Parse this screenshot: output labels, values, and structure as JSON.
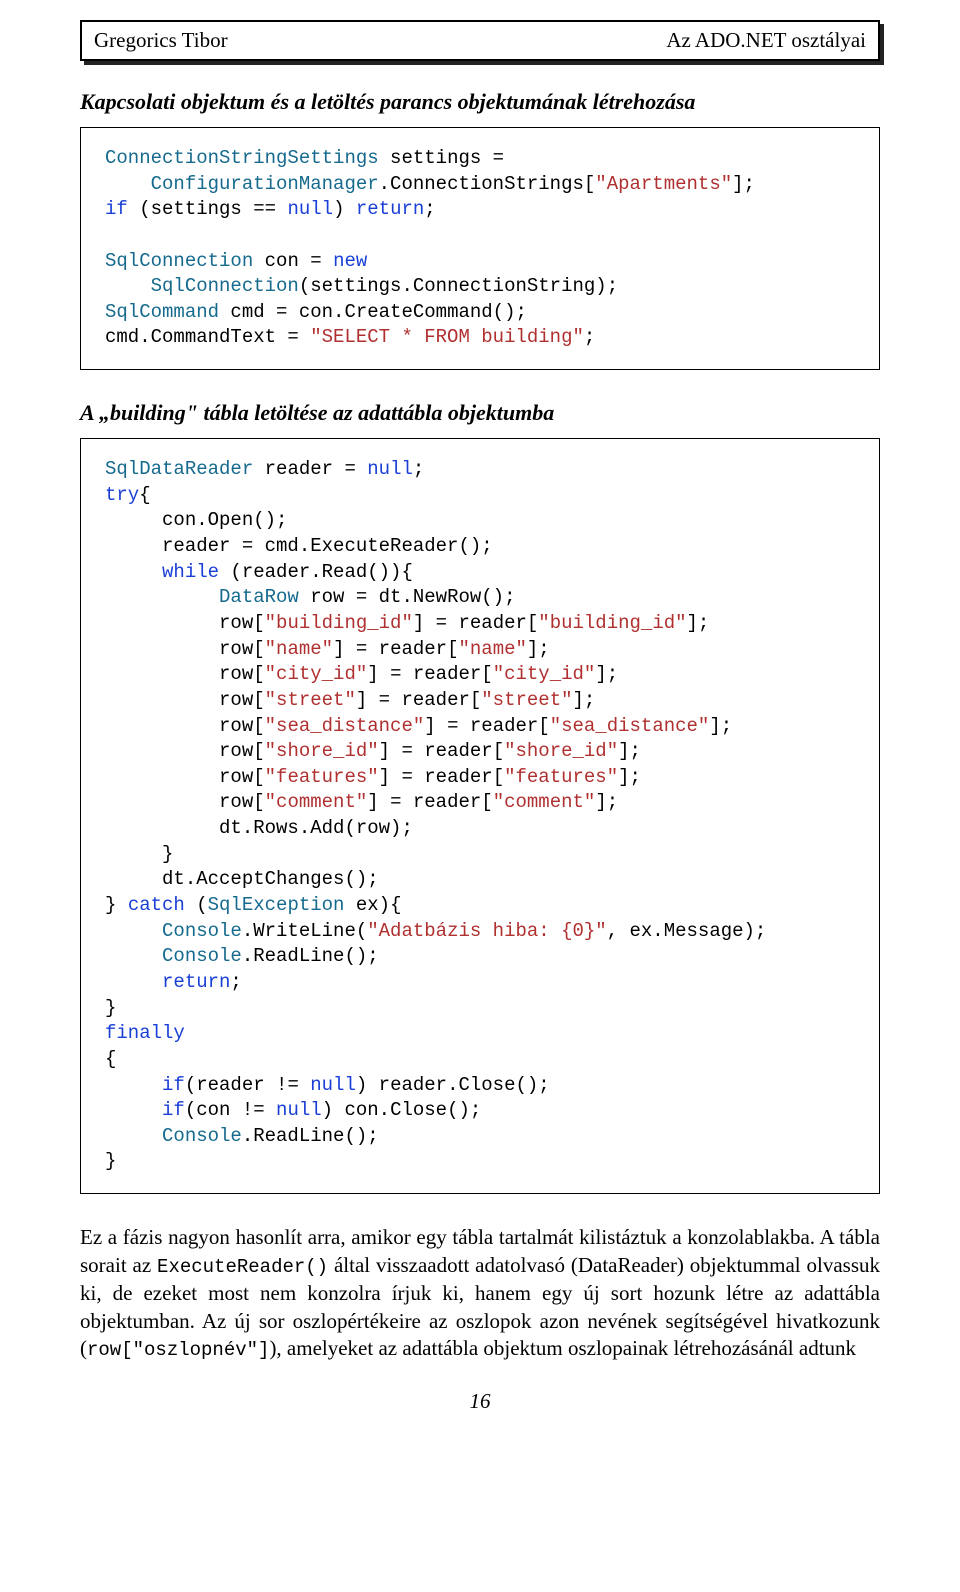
{
  "header": {
    "left": "Gregorics Tibor",
    "right": "Az ADO.NET osztályai"
  },
  "section1": {
    "title_lead": "Kapcsolati objektum és a letöltés parancs objektumának létrehozása"
  },
  "code1": {
    "l1": "ConnectionStringSettings",
    "l1b": " settings = ",
    "l2": "    ConfigurationManager",
    "l2b": ".ConnectionStrings[",
    "l2c": "\"Apartments\"",
    "l2d": "];",
    "l3a": "if",
    "l3b": " (settings == ",
    "l3c": "null",
    "l3d": ") ",
    "l3e": "return",
    "l3f": ";",
    "l5a": "SqlConnection",
    "l5b": " con = ",
    "l5c": "new",
    "l6a": "    SqlConnection",
    "l6b": "(settings.ConnectionString);",
    "l7a": "SqlCommand",
    "l7b": " cmd = con.CreateCommand();",
    "l8a": "cmd.CommandText = ",
    "l8b": "\"SELECT * FROM building\"",
    "l8c": ";"
  },
  "section2": {
    "title_lead": "A „building\" tábla letöltése az adattábla objektumba"
  },
  "code2": {
    "l1a": "SqlDataReader",
    "l1b": " reader = ",
    "l1c": "null",
    "l1d": ";",
    "l2a": "try",
    "l2b": "{",
    "l3": "     con.Open();",
    "l4": "     reader = cmd.ExecuteReader();",
    "l5a": "     while",
    "l5b": " (reader.Read()){",
    "l6a": "          DataRow",
    "l6b": " row = dt.NewRow();",
    "l7a": "          row[",
    "l7b": "\"building_id\"",
    "l7c": "] = reader[",
    "l7d": "\"building_id\"",
    "l7e": "];",
    "l8a": "          row[",
    "l8b": "\"name\"",
    "l8c": "] = reader[",
    "l8d": "\"name\"",
    "l8e": "];",
    "l9a": "          row[",
    "l9b": "\"city_id\"",
    "l9c": "] = reader[",
    "l9d": "\"city_id\"",
    "l9e": "];",
    "l10a": "          row[",
    "l10b": "\"street\"",
    "l10c": "] = reader[",
    "l10d": "\"street\"",
    "l10e": "];",
    "l11a": "          row[",
    "l11b": "\"sea_distance\"",
    "l11c": "] = reader[",
    "l11d": "\"sea_distance\"",
    "l11e": "];",
    "l12a": "          row[",
    "l12b": "\"shore_id\"",
    "l12c": "] = reader[",
    "l12d": "\"shore_id\"",
    "l12e": "];",
    "l13a": "          row[",
    "l13b": "\"features\"",
    "l13c": "] = reader[",
    "l13d": "\"features\"",
    "l13e": "];",
    "l14a": "          row[",
    "l14b": "\"comment\"",
    "l14c": "] = reader[",
    "l14d": "\"comment\"",
    "l14e": "];",
    "l15": "          dt.Rows.Add(row);",
    "l16": "     }",
    "l17": "     dt.AcceptChanges();",
    "l18a": "} ",
    "l18b": "catch",
    "l18c": " (",
    "l18d": "SqlException",
    "l18e": " ex){",
    "l19a": "     Console",
    "l19b": ".WriteLine(",
    "l19c": "\"Adatbázis hiba: {0}\"",
    "l19d": ", ex.Message);",
    "l20a": "     Console",
    "l20b": ".ReadLine();",
    "l21a": "     return",
    "l21b": ";",
    "l22": "}",
    "l23": "finally",
    "l24": "{",
    "l25a": "     if",
    "l25b": "(reader != ",
    "l25c": "null",
    "l25d": ") reader.Close();",
    "l26a": "     if",
    "l26b": "(con != ",
    "l26c": "null",
    "l26d": ") con.Close();",
    "l27a": "     Console",
    "l27b": ".ReadLine();",
    "l28": "}"
  },
  "paragraph": {
    "t1": "Ez a fázis nagyon hasonlít arra, amikor egy tábla tartalmát kilistáztuk a konzolablakba. A tábla sorait az ",
    "m1": "ExecuteReader()",
    "t2": " által visszaadott adatolvasó (DataReader) objektummal olvassuk ki, de ezeket most nem konzolra írjuk ki, hanem egy új sort hozunk létre az adattábla objektumban. Az új sor oszlopértékeire az oszlopok azon nevének segítségével hivatkozunk (",
    "m2": "row[\"oszlopnév\"]",
    "t3": "), amelyeket az adattábla objektum oszlopainak létrehozásánál adtunk"
  },
  "page_num": "16"
}
